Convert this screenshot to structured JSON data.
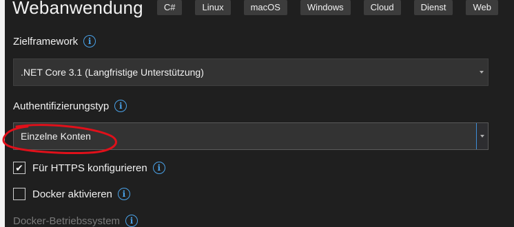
{
  "header": {
    "title": "Webanwendung",
    "tags": [
      "C#",
      "Linux",
      "macOS",
      "Windows",
      "Cloud",
      "Dienst",
      "Web"
    ]
  },
  "target_framework": {
    "label": "Zielframework",
    "value": ".NET Core 3.1 (Langfristige Unterstützung)"
  },
  "auth": {
    "label": "Authentifizierungstyp",
    "value": "Einzelne Konten"
  },
  "https": {
    "label": "Für HTTPS konfigurieren",
    "checked": true,
    "check_glyph": "✔"
  },
  "docker": {
    "label": "Docker aktivieren",
    "checked": false
  },
  "docker_os": {
    "label": "Docker-Betriebssystem"
  },
  "icons": {
    "info": "i"
  },
  "colors": {
    "background": "#1f1f1f",
    "info_icon": "#4aa3ea",
    "annotation": "#e0101a",
    "focus_accent": "#3d8fd8"
  }
}
